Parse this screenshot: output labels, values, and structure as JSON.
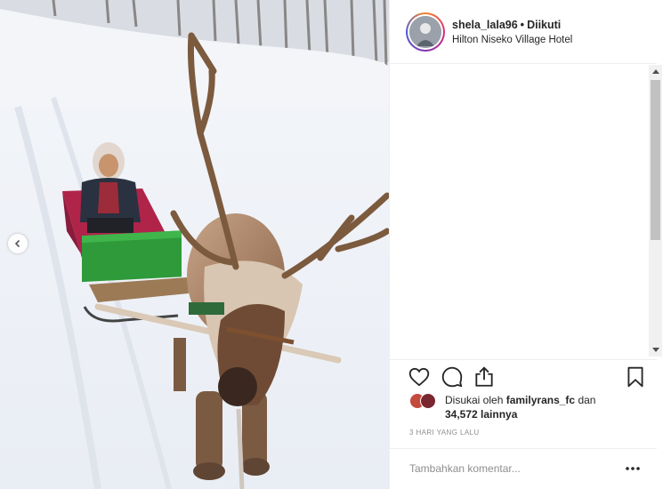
{
  "post": {
    "username": "shela_lala96",
    "separator": "•",
    "follow_status": "Diikuti",
    "location": "Hilton Niseko Village Hotel"
  },
  "likes": {
    "prefix": "Disukai oleh",
    "liker": "familyrans_fc",
    "connector": "dan",
    "count_text": "34,572 lainnya"
  },
  "timestamp": "3 HARI YANG LALU",
  "comment": {
    "placeholder": "Tambahkan komentar..."
  },
  "icons": {
    "like": "heart-icon",
    "comment": "comment-icon",
    "share": "share-icon",
    "save": "bookmark-icon",
    "more": "more-options-icon",
    "prev": "chevron-left-icon"
  },
  "colors": {
    "text": "#262626",
    "muted": "#8e8e8e",
    "border": "#efefef",
    "sled_red": "#b0244a",
    "sled_green": "#2e9a3a"
  }
}
